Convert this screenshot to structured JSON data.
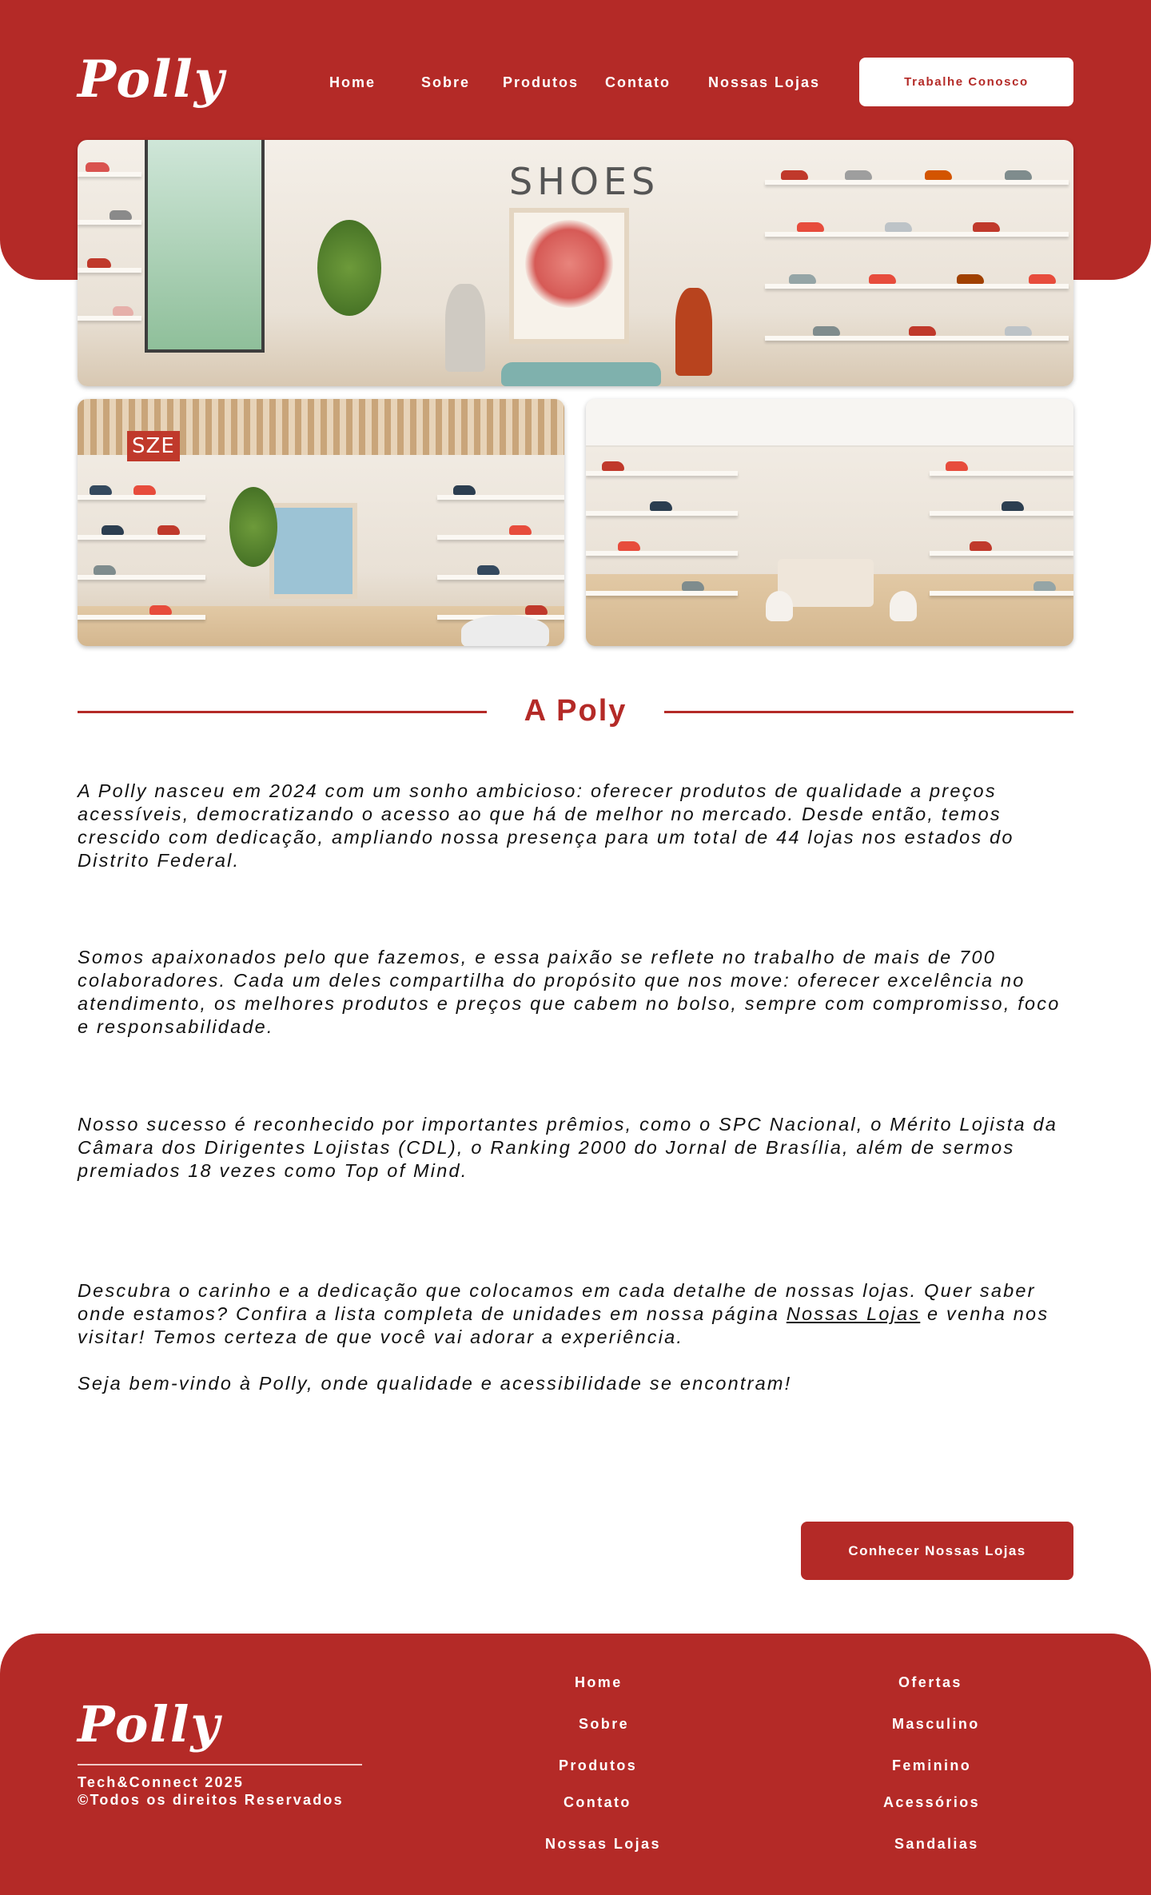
{
  "brand": {
    "logo_text": "Polly",
    "primary_color": "#b42a27",
    "background": "#ffffff"
  },
  "header": {
    "nav": [
      {
        "label": "Home"
      },
      {
        "label": "Sobre"
      },
      {
        "label": "Produtos"
      },
      {
        "label": "Contato"
      },
      {
        "label": "Nossas Lojas"
      }
    ],
    "cta_label": "Trabalhe Conosco"
  },
  "hero": {
    "main_image_sign": "SHOES",
    "side_image_left_sign": "SZE"
  },
  "about": {
    "title": "A Poly",
    "paragraphs": [
      "A Polly nasceu em 2024 com um sonho ambicioso: oferecer produtos de qualidade a preços acessíveis, democratizando o acesso ao que há de melhor no mercado. Desde então, temos crescido com dedicação, ampliando nossa presença para um total de 44 lojas nos estados do Distrito Federal.",
      "Somos apaixonados pelo que fazemos, e essa paixão se reflete no trabalho de mais de 700 colaboradores. Cada um deles compartilha do propósito que nos move: oferecer excelência no atendimento, os melhores produtos e preços que cabem no bolso, sempre com compromisso, foco e responsabilidade.",
      "Nosso sucesso é reconhecido por importantes prêmios, como o SPC Nacional, o Mérito Lojista da Câmara dos Dirigentes Lojistas (CDL), o Ranking 2000 do Jornal de Brasília, além de sermos premiados 18 vezes como Top of Mind."
    ],
    "closing_before_link": "Descubra o carinho e a dedicação que colocamos em cada detalhe de nossas lojas. Quer saber onde estamos? Confira a lista completa de unidades em nossa página",
    "closing_link": "Nossas Lojas",
    "closing_after_link": "e venha nos visitar! Temos certeza de que você vai adorar a experiência.",
    "welcome": "Seja bem-vindo à Polly, onde qualidade e acessibilidade se encontram!",
    "cta_label": "Conhecer Nossas Lojas"
  },
  "footer": {
    "logo_text": "Polly",
    "copyright_line1": "Tech&Connect 2025",
    "copyright_line2": "©Todos os direitos Reservados",
    "nav_col1": [
      {
        "label": "Home"
      },
      {
        "label": "Sobre"
      },
      {
        "label": "Produtos"
      },
      {
        "label": "Contato"
      },
      {
        "label": "Nossas Lojas"
      }
    ],
    "nav_col2": [
      {
        "label": "Ofertas"
      },
      {
        "label": "Masculino"
      },
      {
        "label": "Feminino"
      },
      {
        "label": "Acessórios"
      },
      {
        "label": "Sandalias"
      }
    ]
  }
}
